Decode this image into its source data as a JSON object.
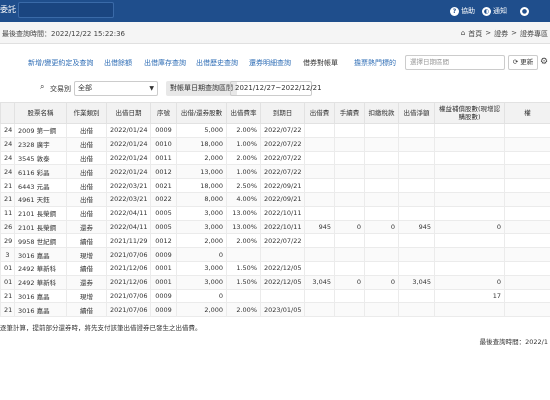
{
  "topbar": {
    "app_title": "委託",
    "help": "協助",
    "notify": "通知",
    "help_icon": "question-icon",
    "notify_icon": "toggle-icon"
  },
  "infobar": {
    "query_time": "最後查詢時間：2022/12/22 15:22:36",
    "breadcrumb": [
      "首頁",
      "證券",
      "證券專區"
    ],
    "home_icon": "home-icon"
  },
  "tabs": [
    "新增/變更約定及查詢",
    "出借餘額",
    "出借庫存查詢",
    "出借歷史查詢",
    "還券明細查詢",
    "借券對帳單",
    "擔票熱門標的"
  ],
  "active_tab": "借券對帳單",
  "highlight_color": "#e02020",
  "date_range": {
    "placeholder": "選擇日期區間"
  },
  "refresh_label": "更新",
  "filters": {
    "type_label": "交易別",
    "type_value": "全部",
    "range_label": "對帳單日期查詢區間",
    "range_value": "2021/12/27~2022/12/21"
  },
  "table": {
    "headers": [
      "",
      "股票名稱",
      "作業類別",
      "出借日期",
      "序號",
      "出借/還券股數",
      "出借費率",
      "到期日",
      "出借費",
      "手續費",
      "扣繳稅款",
      "出借淨額",
      "權益補償股數(現增認購股數)",
      "權"
    ],
    "rows": [
      [
        "24",
        "2009 第一鋼",
        "出借",
        "2022/01/24",
        "0009",
        "5,000",
        "2.00%",
        "2022/07/22",
        "",
        "",
        "",
        "",
        "",
        ""
      ],
      [
        "24",
        "2328 廣宇",
        "出借",
        "2022/01/24",
        "0010",
        "18,000",
        "1.00%",
        "2022/07/22",
        "",
        "",
        "",
        "",
        "",
        ""
      ],
      [
        "24",
        "3545 敦泰",
        "出借",
        "2022/01/24",
        "0011",
        "2,000",
        "2.00%",
        "2022/07/22",
        "",
        "",
        "",
        "",
        "",
        ""
      ],
      [
        "24",
        "6116 彩晶",
        "出借",
        "2022/01/24",
        "0012",
        "13,000",
        "1.00%",
        "2022/07/22",
        "",
        "",
        "",
        "",
        "",
        ""
      ],
      [
        "21",
        "6443 元晶",
        "出借",
        "2022/03/21",
        "0021",
        "18,000",
        "2.50%",
        "2022/09/21",
        "",
        "",
        "",
        "",
        "",
        ""
      ],
      [
        "21",
        "4961 天鈺",
        "出借",
        "2022/03/21",
        "0022",
        "8,000",
        "4.00%",
        "2022/09/21",
        "",
        "",
        "",
        "",
        "",
        ""
      ],
      [
        "11",
        "2101 長榮鋼",
        "出借",
        "2022/04/11",
        "0005",
        "3,000",
        "13.00%",
        "2022/10/11",
        "",
        "",
        "",
        "",
        "",
        ""
      ],
      [
        "26",
        "2101 長榮鋼",
        "還券",
        "2022/04/11",
        "0005",
        "3,000",
        "13.00%",
        "2022/10/11",
        "945",
        "0",
        "0",
        "945",
        "0",
        ""
      ],
      [
        "29",
        "9958 世紀鋼",
        "續借",
        "2021/11/29",
        "0012",
        "2,000",
        "2.00%",
        "2022/07/22",
        "",
        "",
        "",
        "",
        "",
        ""
      ],
      [
        "3",
        "3016 嘉晶",
        "現增",
        "2021/07/06",
        "0009",
        "0",
        "",
        "",
        "",
        "",
        "",
        "",
        "",
        ""
      ],
      [
        "01",
        "2492 華新科",
        "續借",
        "2021/12/06",
        "0001",
        "3,000",
        "1.50%",
        "2022/12/05",
        "",
        "",
        "",
        "",
        "",
        ""
      ],
      [
        "01",
        "2492 華新科",
        "還券",
        "2021/12/06",
        "0001",
        "3,000",
        "1.50%",
        "2022/12/05",
        "3,045",
        "0",
        "0",
        "3,045",
        "0",
        ""
      ],
      [
        "21",
        "3016 嘉晶",
        "現增",
        "2021/07/06",
        "0009",
        "0",
        "",
        "",
        "",
        "",
        "",
        "",
        "17",
        ""
      ],
      [
        "21",
        "3016 嘉晶",
        "續借",
        "2021/07/06",
        "0009",
        "2,000",
        "2.00%",
        "2023/01/05",
        "",
        "",
        "",
        "",
        "",
        ""
      ]
    ]
  },
  "footnote": "逐筆計算，提前部分還券時，將先支付該筆出借證券已發生之出借費。",
  "last_query": "最後查詢時間：2022/1"
}
